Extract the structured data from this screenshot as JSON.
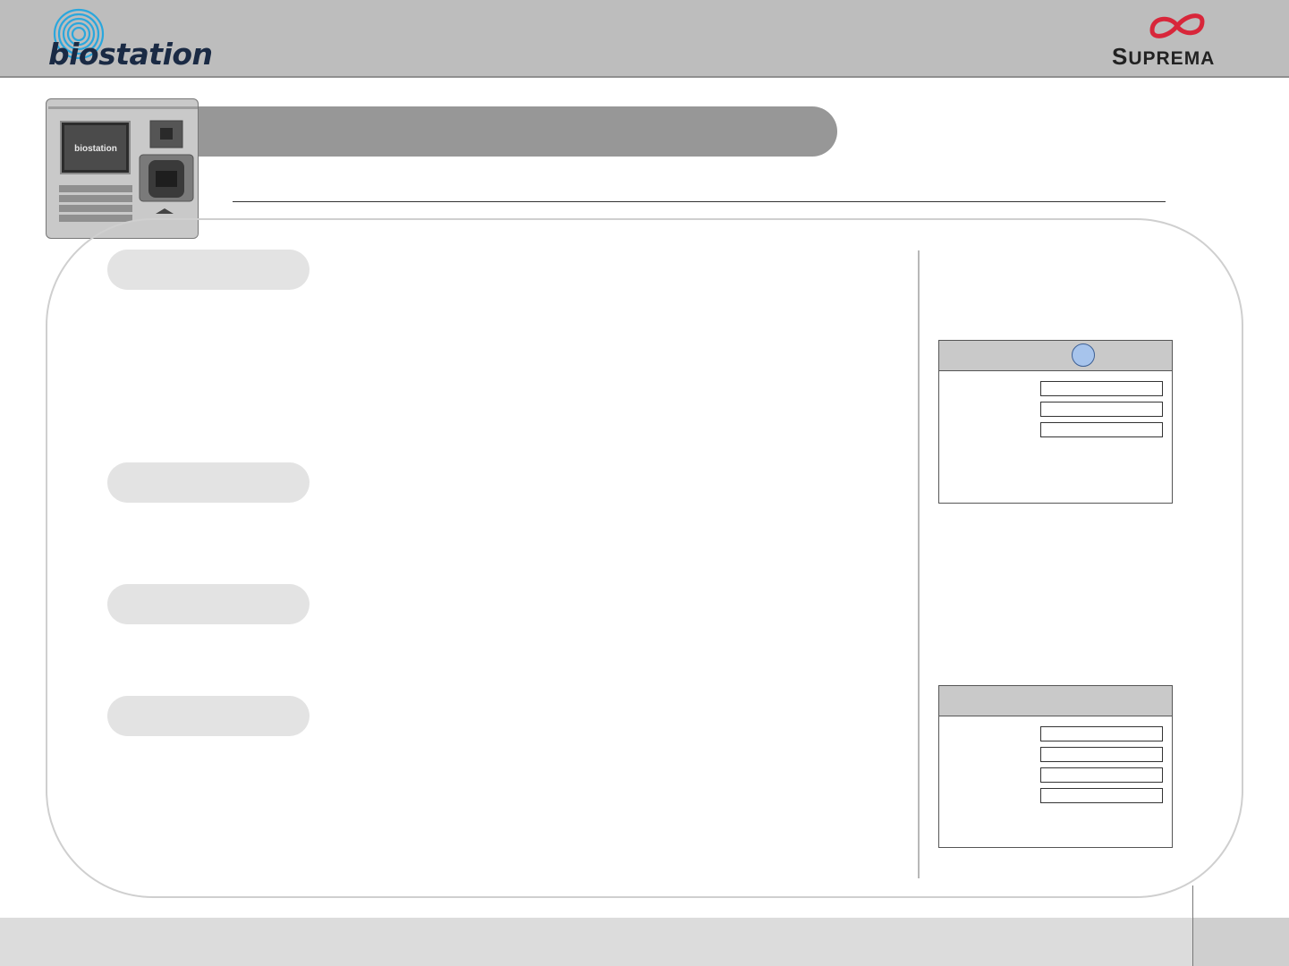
{
  "header": {
    "brand_left": "biostation",
    "brand_right_initial": "S",
    "brand_right_rest": "UPREMA",
    "colors": {
      "header_bg": "#bdbdbd",
      "supreme_red": "#d8263a",
      "biostation_blue": "#29a9e0"
    }
  },
  "device": {
    "screen_text": "biostation"
  },
  "icons": {
    "device": "device-icon",
    "rings": "fingerprint-rings-icon",
    "infinity": "infinity-logo-icon"
  }
}
